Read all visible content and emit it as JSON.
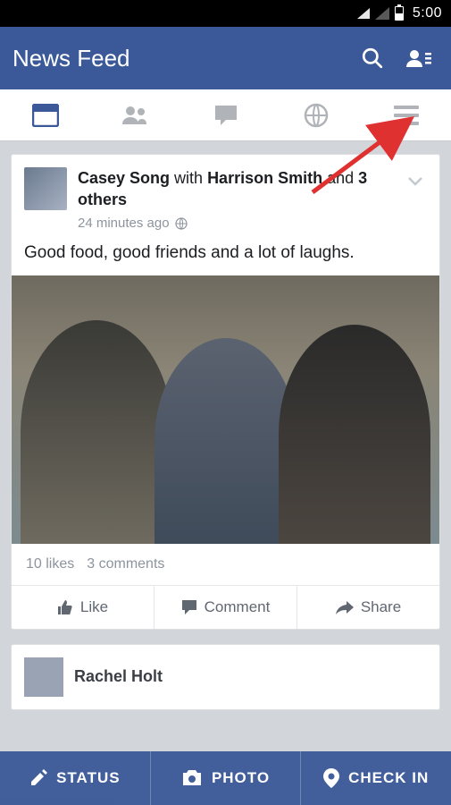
{
  "status_bar": {
    "time": "5:00"
  },
  "app_bar": {
    "title": "News Feed"
  },
  "tabs": {
    "items": [
      {
        "name": "feed",
        "active": true
      },
      {
        "name": "friends",
        "active": false
      },
      {
        "name": "messages",
        "active": false
      },
      {
        "name": "notifications",
        "active": false
      },
      {
        "name": "menu",
        "active": false
      }
    ]
  },
  "posts": [
    {
      "author": "Casey Song",
      "with_prefix": " with ",
      "tagged": "Harrison Smith",
      "tagged_suffix": " and ",
      "others": "3 others",
      "timestamp": "24 minutes ago",
      "privacy": "public",
      "text": "Good food, good friends and a lot of laughs.",
      "likes_label": "10 likes",
      "comments_label": "3 comments",
      "actions": {
        "like": "Like",
        "comment": "Comment",
        "share": "Share"
      }
    },
    {
      "author": "Rachel Holt"
    }
  ],
  "composer": {
    "status": "STATUS",
    "photo": "PHOTO",
    "checkin": "CHECK IN"
  },
  "annotation": {
    "arrow_target": "menu-tab"
  }
}
